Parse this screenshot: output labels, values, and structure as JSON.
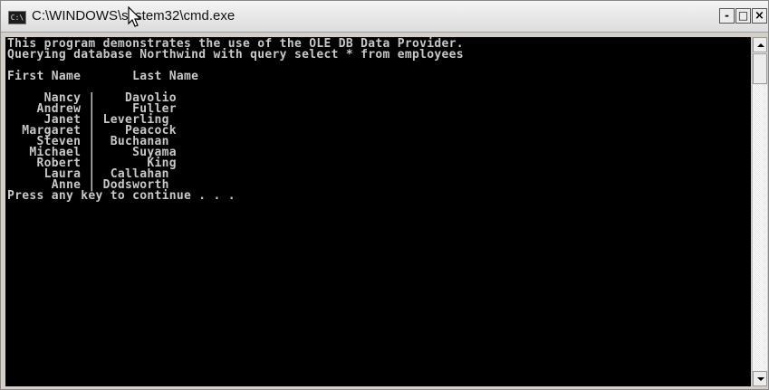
{
  "window": {
    "title": "C:\\WINDOWS\\system32\\cmd.exe",
    "icon_label": "C:\\",
    "buttons": {
      "minimize": "-",
      "maximize": "□",
      "close": "×"
    }
  },
  "console": {
    "lines": {
      "intro1": "This program demonstrates the use of the OLE DB Data Provider.",
      "intro2": "Querying database Northwind with query select * from employees",
      "header": "First Name       Last Name",
      "footer": "Press any key to continue . . ."
    },
    "rows": [
      "     Nancy |    Davolio",
      "    Andrew |     Fuller",
      "     Janet | Leverling",
      "  Margaret |    Peacock",
      "    Steven |  Buchanan",
      "   Michael |     Suyama",
      "    Robert |       King",
      "     Laura |  Callahan",
      "      Anne | Dodsworth"
    ]
  },
  "icons": {
    "app": "console-icon",
    "cursor": "mouse-pointer-icon",
    "scroll_up": "scroll-up-arrow-icon",
    "scroll_down": "scroll-down-arrow-icon"
  },
  "colors": {
    "console_bg": "#000000",
    "console_text": "#c8c8c8"
  }
}
